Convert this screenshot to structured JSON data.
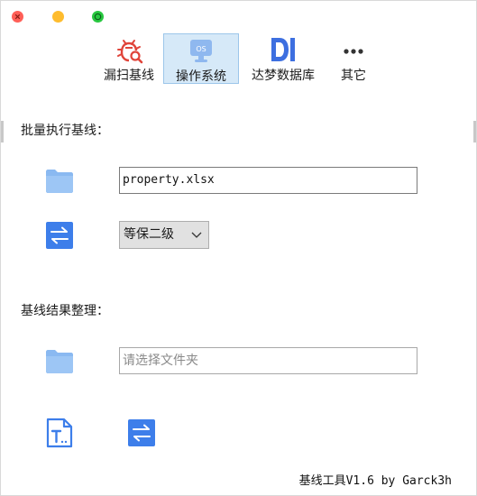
{
  "toolbar": {
    "tabs": [
      {
        "label": "漏扫基线",
        "icon": "bug-scan-icon"
      },
      {
        "label": "操作系统",
        "icon": "os-monitor-icon",
        "active": true
      },
      {
        "label": "达梦数据库",
        "icon": "dm-database-icon"
      },
      {
        "label": "其它",
        "icon": "more-dots-icon"
      }
    ],
    "os_icon_text": "OS"
  },
  "batch": {
    "title": "批量执行基线：",
    "file_value": "property.xlsx",
    "level_selected": "等保二级"
  },
  "results": {
    "title": "基线结果整理：",
    "folder_placeholder": "请选择文件夹"
  },
  "footer": {
    "text": "基线工具V1.6 by Garck3h"
  },
  "colors": {
    "accent_blue": "#3d7eea",
    "folder_blue": "#8ab9f1",
    "active_tab_bg": "#d6e9f8",
    "bug_red": "#e0443a"
  }
}
